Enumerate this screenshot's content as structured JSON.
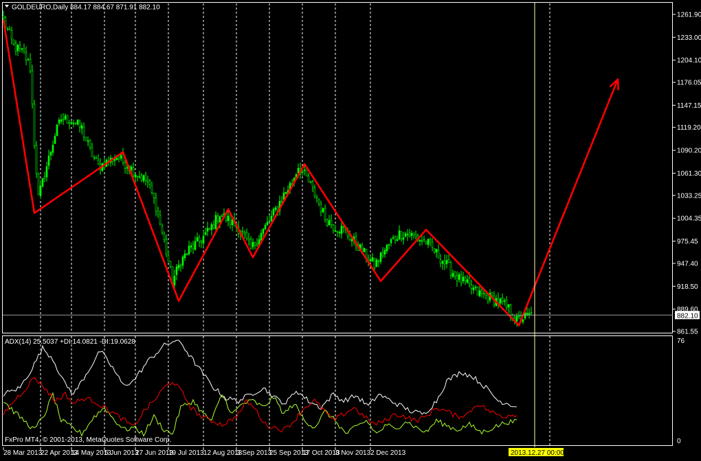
{
  "header": {
    "symbol": "GOLDEURO,Daily",
    "ohlc": "884.17 884.67 871.91 882.10"
  },
  "indicator": {
    "label": "ADX(14) 25.5037 +DI:14.0821 -DI:19.0628",
    "scale_top": "76",
    "scale_bottom": "0"
  },
  "footer": {
    "copyright": "FxPro MT4, © 2001-2013, MetaQuotes Software Corp."
  },
  "current_price_label": "882.10",
  "crosshair_date_label": "2013.12.27 00:00",
  "colors": {
    "background": "#000000",
    "bull_candle": "#00ff00",
    "bear_candle": "#000000",
    "candle_outline": "#00ff00",
    "zigzag": "#ff0000",
    "adx_line": "#ffffff",
    "plus_di": "#adff2f",
    "minus_di": "#ff0000",
    "grid": "#ffffff",
    "axis_text": "#ffffff",
    "crosshair": "#ffffaa",
    "date_label_bg": "#ffff00"
  },
  "chart_data": [
    {
      "type": "candlestick",
      "title": "GOLDEURO,Daily",
      "ylim": [
        861.55,
        1261.9
      ],
      "price_axis_ticks": [
        "1261.90",
        "1233.00",
        "1204.10",
        "1176.05",
        "1147.15",
        "1119.20",
        "1090.20",
        "1061.30",
        "1033.25",
        "1004.35",
        "975.45",
        "947.40",
        "918.50",
        "889.60",
        "861.55"
      ],
      "date_ticks": [
        "28 Mar 2013",
        "22 Apr 2013",
        "14 May 2013",
        "5 Jun 2013",
        "27 Jun 2013",
        "19 Jul 2013",
        "12 Aug 2013",
        "3 Sep 2013",
        "25 Sep 2013",
        "17 Oct 2013",
        "8 Nov 2013",
        "2 Dec 2013"
      ],
      "vertical_grid": "dashed",
      "close_anchors": [
        [
          0,
          1255
        ],
        [
          5,
          1222
        ],
        [
          10,
          1212
        ],
        [
          13,
          1195
        ],
        [
          15,
          1100
        ],
        [
          17,
          1030
        ],
        [
          20,
          1060
        ],
        [
          25,
          1110
        ],
        [
          28,
          1130
        ],
        [
          33,
          1128
        ],
        [
          38,
          1118
        ],
        [
          42,
          1090
        ],
        [
          46,
          1070
        ],
        [
          50,
          1075
        ],
        [
          55,
          1082
        ],
        [
          60,
          1072
        ],
        [
          65,
          1060
        ],
        [
          70,
          1050
        ],
        [
          74,
          1020
        ],
        [
          78,
          975
        ],
        [
          82,
          925
        ],
        [
          86,
          950
        ],
        [
          90,
          965
        ],
        [
          95,
          975
        ],
        [
          100,
          990
        ],
        [
          105,
          1010
        ],
        [
          110,
          1000
        ],
        [
          115,
          990
        ],
        [
          120,
          965
        ],
        [
          125,
          985
        ],
        [
          130,
          1005
        ],
        [
          135,
          1030
        ],
        [
          140,
          1050
        ],
        [
          143,
          1070
        ],
        [
          147,
          1055
        ],
        [
          152,
          1030
        ],
        [
          156,
          1005
        ],
        [
          160,
          995
        ],
        [
          165,
          990
        ],
        [
          170,
          975
        ],
        [
          175,
          960
        ],
        [
          180,
          945
        ],
        [
          184,
          960
        ],
        [
          188,
          975
        ],
        [
          192,
          985
        ],
        [
          196,
          985
        ],
        [
          200,
          980
        ],
        [
          205,
          975
        ],
        [
          210,
          960
        ],
        [
          215,
          945
        ],
        [
          220,
          930
        ],
        [
          225,
          920
        ],
        [
          230,
          910
        ],
        [
          235,
          905
        ],
        [
          240,
          900
        ],
        [
          245,
          890
        ],
        [
          249,
          875
        ],
        [
          253,
          880
        ],
        [
          256,
          882.1
        ]
      ],
      "zigzag": [
        [
          0,
          1255
        ],
        [
          15,
          1011
        ],
        [
          58,
          1088
        ],
        [
          85,
          900
        ],
        [
          109,
          1016
        ],
        [
          121,
          955
        ],
        [
          146,
          1073
        ],
        [
          183,
          925
        ],
        [
          205,
          990
        ],
        [
          250,
          869
        ],
        [
          298,
          1180
        ]
      ]
    },
    {
      "type": "line",
      "title": "ADX(14) 25.5037 +DI:14.0821 -DI:19.0628",
      "ylim": [
        0,
        76
      ],
      "series": [
        {
          "name": "ADX(14)",
          "anchors": [
            [
              0,
              35
            ],
            [
              8,
              40
            ],
            [
              14,
              55
            ],
            [
              19,
              70
            ],
            [
              24,
              62
            ],
            [
              29,
              45
            ],
            [
              34,
              35
            ],
            [
              40,
              50
            ],
            [
              47,
              68
            ],
            [
              53,
              55
            ],
            [
              58,
              42
            ],
            [
              63,
              45
            ],
            [
              70,
              60
            ],
            [
              78,
              72
            ],
            [
              85,
              77
            ],
            [
              90,
              65
            ],
            [
              97,
              50
            ],
            [
              102,
              40
            ],
            [
              108,
              32
            ],
            [
              114,
              30
            ],
            [
              120,
              35
            ],
            [
              126,
              40
            ],
            [
              132,
              32
            ],
            [
              137,
              28
            ],
            [
              142,
              38
            ],
            [
              148,
              30
            ],
            [
              154,
              25
            ],
            [
              160,
              35
            ],
            [
              165,
              30
            ],
            [
              171,
              34
            ],
            [
              177,
              26
            ],
            [
              182,
              35
            ],
            [
              188,
              30
            ],
            [
              193,
              26
            ],
            [
              198,
              22
            ],
            [
              204,
              20
            ],
            [
              210,
              30
            ],
            [
              215,
              45
            ],
            [
              222,
              52
            ],
            [
              228,
              48
            ],
            [
              234,
              40
            ],
            [
              240,
              30
            ],
            [
              245,
              28
            ],
            [
              249,
              25.5
            ]
          ]
        },
        {
          "name": "+DI",
          "anchors": [
            [
              0,
              30
            ],
            [
              5,
              22
            ],
            [
              10,
              15
            ],
            [
              15,
              8
            ],
            [
              20,
              20
            ],
            [
              24,
              35
            ],
            [
              28,
              15
            ],
            [
              33,
              10
            ],
            [
              38,
              5
            ],
            [
              44,
              18
            ],
            [
              49,
              25
            ],
            [
              54,
              15
            ],
            [
              59,
              8
            ],
            [
              63,
              10
            ],
            [
              68,
              5
            ],
            [
              73,
              18
            ],
            [
              78,
              8
            ],
            [
              82,
              5
            ],
            [
              86,
              25
            ],
            [
              92,
              30
            ],
            [
              97,
              20
            ],
            [
              101,
              15
            ],
            [
              106,
              35
            ],
            [
              111,
              20
            ],
            [
              116,
              28
            ],
            [
              121,
              30
            ],
            [
              126,
              25
            ],
            [
              131,
              33
            ],
            [
              136,
              20
            ],
            [
              141,
              28
            ],
            [
              146,
              15
            ],
            [
              151,
              10
            ],
            [
              156,
              22
            ],
            [
              161,
              15
            ],
            [
              166,
              5
            ],
            [
              171,
              10
            ],
            [
              176,
              15
            ],
            [
              181,
              5
            ],
            [
              186,
              12
            ],
            [
              190,
              8
            ],
            [
              195,
              15
            ],
            [
              200,
              10
            ],
            [
              205,
              6
            ],
            [
              210,
              15
            ],
            [
              214,
              12
            ],
            [
              220,
              8
            ],
            [
              226,
              12
            ],
            [
              232,
              6
            ],
            [
              238,
              10
            ],
            [
              244,
              14
            ],
            [
              249,
              14.1
            ]
          ]
        },
        {
          "name": "-DI",
          "anchors": [
            [
              0,
              20
            ],
            [
              5,
              30
            ],
            [
              10,
              38
            ],
            [
              15,
              48
            ],
            [
              20,
              40
            ],
            [
              25,
              30
            ],
            [
              30,
              35
            ],
            [
              34,
              28
            ],
            [
              39,
              32
            ],
            [
              44,
              30
            ],
            [
              49,
              25
            ],
            [
              54,
              20
            ],
            [
              59,
              15
            ],
            [
              63,
              10
            ],
            [
              68,
              22
            ],
            [
              73,
              30
            ],
            [
              78,
              40
            ],
            [
              82,
              45
            ],
            [
              86,
              38
            ],
            [
              91,
              25
            ],
            [
              96,
              18
            ],
            [
              101,
              15
            ],
            [
              106,
              12
            ],
            [
              110,
              15
            ],
            [
              114,
              20
            ],
            [
              118,
              30
            ],
            [
              122,
              24
            ],
            [
              127,
              12
            ],
            [
              131,
              10
            ],
            [
              136,
              8
            ],
            [
              141,
              15
            ],
            [
              146,
              25
            ],
            [
              151,
              30
            ],
            [
              156,
              22
            ],
            [
              160,
              15
            ],
            [
              165,
              20
            ],
            [
              170,
              25
            ],
            [
              175,
              18
            ],
            [
              180,
              12
            ],
            [
              185,
              15
            ],
            [
              190,
              20
            ],
            [
              195,
              18
            ],
            [
              200,
              15
            ],
            [
              205,
              18
            ],
            [
              210,
              25
            ],
            [
              215,
              22
            ],
            [
              220,
              18
            ],
            [
              225,
              20
            ],
            [
              230,
              28
            ],
            [
              236,
              22
            ],
            [
              242,
              18
            ],
            [
              247,
              20
            ],
            [
              249,
              19.1
            ]
          ]
        }
      ]
    }
  ]
}
